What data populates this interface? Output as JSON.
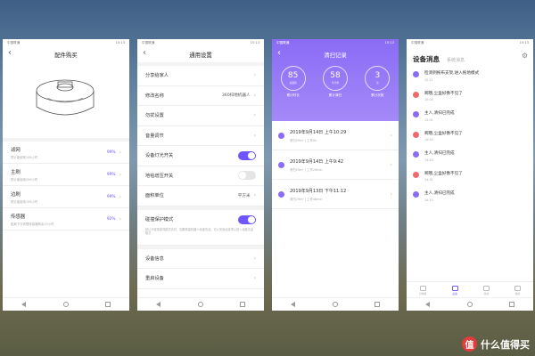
{
  "status_bar": {
    "left": "中国联通",
    "right": "15:13"
  },
  "phone1": {
    "title": "配件购买",
    "parts": [
      {
        "name": "滤网",
        "sub": "预计能使用149小时",
        "pct": "99%"
      },
      {
        "name": "主刷",
        "sub": "预计能使用299小时",
        "pct": "99%"
      },
      {
        "name": "边刷",
        "sub": "预计能使用199小时",
        "pct": "99%"
      },
      {
        "name": "传感器",
        "sub": "距离下次清理传感器剩余19小时",
        "pct": "92%"
      }
    ]
  },
  "phone2": {
    "title": "通用设置",
    "rows": [
      {
        "label": "分享给家人",
        "value": ""
      },
      {
        "label": "修改名称",
        "value": "360扫地机器人"
      },
      {
        "label": "勿扰设置",
        "value": ""
      },
      {
        "label": "音量调节",
        "value": ""
      },
      {
        "label": "设备灯光开关",
        "value": ""
      },
      {
        "label": "地毯增压开关",
        "value": ""
      },
      {
        "label": "面积单位",
        "value": "平方米"
      }
    ],
    "carpet": {
      "label": "碰撞保护模式",
      "desc": "默认不碰撞家具模式清扫，如果希望机器人深度清洁，可以关闭此选项以进入深度清洁模式"
    },
    "rows2": [
      {
        "label": "设备信息"
      },
      {
        "label": "重启设备"
      }
    ]
  },
  "phone3": {
    "title": "清扫记录",
    "stats": [
      {
        "num": "85",
        "unit": "总面积",
        "label": "累计时长"
      },
      {
        "num": "58",
        "unit": "平方米",
        "label": "累计清扫"
      },
      {
        "num": "3",
        "unit": "次",
        "label": "累计次数"
      }
    ],
    "records": [
      {
        "date": "2019年9月14日 上午10:29",
        "sub": "清扫29m² | 工作0h"
      },
      {
        "date": "2019年9月14日 上午9:42",
        "sub": "清扫29m² | 工作29min"
      },
      {
        "date": "2019年9月13日 下午11:12",
        "sub": "清扫29m² | 工作46min"
      }
    ]
  },
  "phone4": {
    "title": "设备消息",
    "subtitle": "系统消息",
    "messages": [
      {
        "text": "检测到拖布支架,进入拖地模式",
        "time": "15:11",
        "color": "#8a6cf5"
      },
      {
        "text": "啊哦,尘盒好像不见了",
        "time": "15:04",
        "color": "#ef6b6b"
      },
      {
        "text": "主人,清扫已完成",
        "time": "15:01",
        "color": "#8a6cf5"
      },
      {
        "text": "啊哦,尘盒好像不见了",
        "time": "14:54",
        "color": "#ef6b6b"
      },
      {
        "text": "主人,清扫已完成",
        "time": "14:43",
        "color": "#8a6cf5"
      },
      {
        "text": "啊哦,尘盒好像不见了",
        "time": "14:31",
        "color": "#ef6b6b"
      },
      {
        "text": "主人,清扫已完成",
        "time": "14:15",
        "color": "#8a6cf5"
      }
    ],
    "tabs": [
      "扫地机",
      "设备",
      "商城",
      "我的"
    ]
  },
  "watermark": {
    "logo": "值",
    "text": "什么值得买"
  },
  "colors": {
    "accent": "#6d55ff",
    "header_purple": "#8a6cf5",
    "alert_red": "#ef6b6b"
  }
}
